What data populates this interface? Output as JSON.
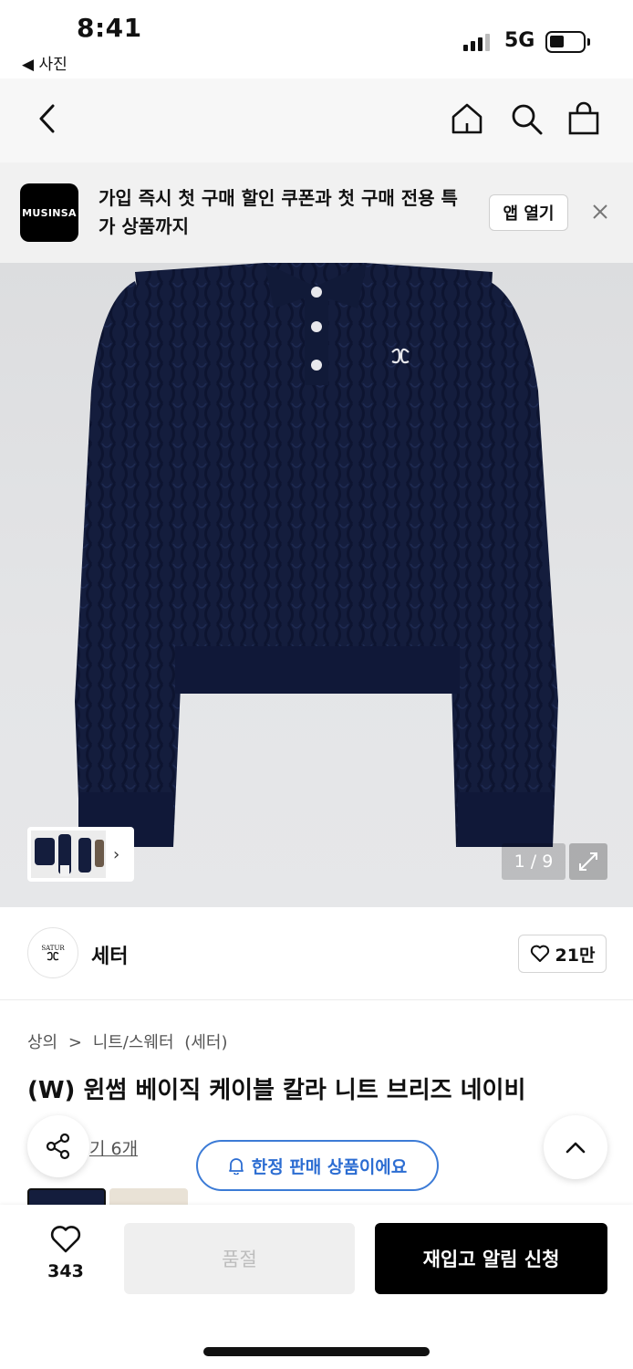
{
  "status_bar": {
    "time": "8:41",
    "back_app": "◀ 사진",
    "network": "5G"
  },
  "header": {
    "back_icon": "chevron-left-icon",
    "home_icon": "home-icon",
    "search_icon": "search-icon",
    "bag_icon": "shopping-bag-icon"
  },
  "promo": {
    "logo": "MUSINSA",
    "text": "가입 즉시 첫 구매 할인 쿠폰과 첫 구매 전용 특가 상품까지",
    "open_label": "앱 열기",
    "close_icon": "close-icon"
  },
  "gallery": {
    "counter": "1 / 9",
    "expand_icon": "expand-icon",
    "thumb_arrow": "›"
  },
  "brand": {
    "logo_text": "SATUR",
    "name": "세터",
    "likes": "21만"
  },
  "product": {
    "breadcrumb": [
      "상의",
      ">",
      "니트/스웨터",
      "(세터)"
    ],
    "title": "(W) 윈썸 베이직 케이블 칼라 니트 브리즈 네이비",
    "review_link": "기 6개",
    "limited_label": "한정 판매 상품이에요"
  },
  "purchase_bar": {
    "wish_count": "343",
    "soldout_label": "품절",
    "restock_label": "재입고 알림 신청"
  },
  "colors": {
    "navy": "#141d3d",
    "banner_blue": "#2c6dd2"
  }
}
